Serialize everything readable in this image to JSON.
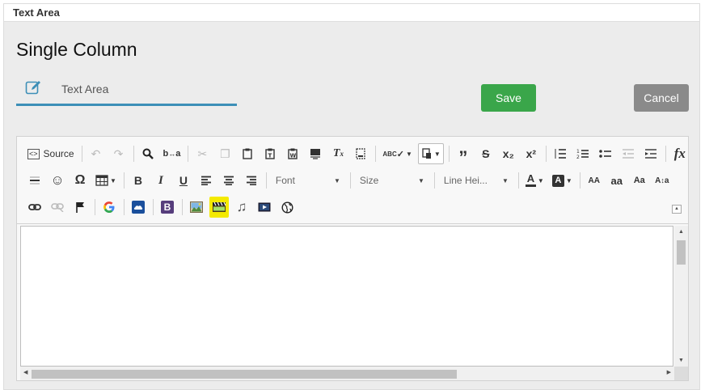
{
  "panel": {
    "header": "Text Area"
  },
  "page_title": "Single Column",
  "name_field": {
    "value": "Text Area",
    "placeholder": ""
  },
  "buttons": {
    "save": "Save",
    "cancel": "Cancel"
  },
  "toolbar": {
    "source_label": "Source",
    "font_combo": "Font",
    "size_combo": "Size",
    "line_height_combo": "Line Hei...",
    "row1_icons": [
      "source-icon",
      "undo-icon",
      "redo-icon",
      "find-icon",
      "replace-icon",
      "cut-icon",
      "copy-icon",
      "paste-icon",
      "paste-text-icon",
      "paste-word-icon",
      "template-icon",
      "remove-format-icon",
      "show-blocks-icon",
      "spell-check-icon",
      "format-painter-icon",
      "blockquote-icon",
      "strikethrough-icon",
      "subscript-icon",
      "superscript-icon",
      "line-spacing-icon",
      "numbered-list-icon",
      "bulleted-list-icon",
      "decrease-indent-icon",
      "increase-indent-icon",
      "formula-icon"
    ],
    "row2_icons": [
      "horizontal-line-icon",
      "emoji-icon",
      "special-character-icon",
      "table-icon",
      "bold-icon",
      "italic-icon",
      "underline-icon",
      "align-left-icon",
      "align-center-icon",
      "align-right-icon",
      "text-color-icon",
      "background-color-icon",
      "uppercase-icon",
      "lowercase-icon",
      "capitalize-icon",
      "transform-case-icon"
    ],
    "row3_icons": [
      "link-icon",
      "unlink-icon",
      "anchor-flag-icon",
      "google-icon",
      "onedrive-icon",
      "bootstrap-icon",
      "image-icon",
      "video-icon",
      "audio-icon",
      "media-embed-icon",
      "globe-icon"
    ],
    "labels": {
      "subscript": "x₂",
      "superscript": "x²",
      "uppercase": "AA",
      "lowercase": "aa",
      "capitalize": "Aa",
      "formula": "fx",
      "bold": "B",
      "italic": "I",
      "underline": "U",
      "strike": "S",
      "text_color": "A",
      "bg_color": "A",
      "omega": "Ω",
      "abc": "ABC"
    }
  },
  "colors": {
    "save": "#3aa64a",
    "cancel": "#8a8a8a",
    "underline_accent": "#3d8fb7",
    "video_highlight": "#f4ea00"
  }
}
